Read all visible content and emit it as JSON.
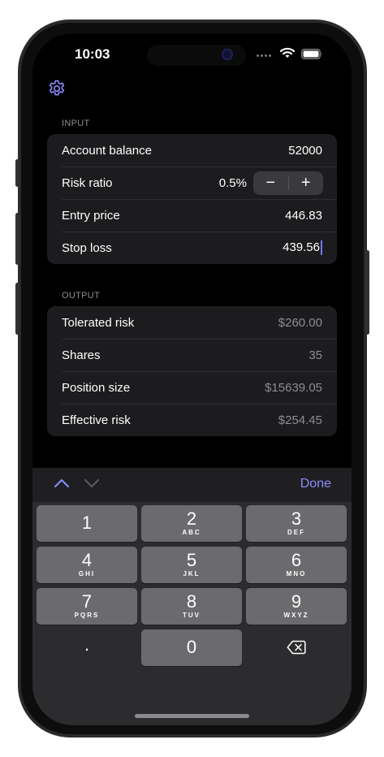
{
  "status_bar": {
    "time": "10:03"
  },
  "icons": {
    "settings": "gear-icon",
    "wifi": "wifi-icon",
    "battery": "battery-icon",
    "signal": "cellular-signal-icon",
    "prev": "chevron-up-icon",
    "next": "chevron-down-icon",
    "delete": "delete-backspace-icon"
  },
  "colors": {
    "accent": "#8c8cff",
    "background": "#000000",
    "group": "#1c1c1e",
    "muted_text": "#8d8d93",
    "key": "#6b6b6e",
    "keyboard_bg": "#2c2c2e"
  },
  "input": {
    "section_label": "INPUT",
    "account_balance": {
      "label": "Account balance",
      "value": "52000"
    },
    "risk_ratio": {
      "label": "Risk ratio",
      "value": "0.5%",
      "decrement": "−",
      "increment": "+"
    },
    "entry_price": {
      "label": "Entry price",
      "value": "446.83"
    },
    "stop_loss": {
      "label": "Stop loss",
      "value": "439.56"
    }
  },
  "output": {
    "section_label": "OUTPUT",
    "tolerated_risk": {
      "label": "Tolerated risk",
      "value": "$260.00"
    },
    "shares": {
      "label": "Shares",
      "value": "35"
    },
    "position_size": {
      "label": "Position size",
      "value": "$15639.05"
    },
    "effective_risk": {
      "label": "Effective risk",
      "value": "$254.45"
    }
  },
  "keyboard_toolbar": {
    "done_label": "Done"
  },
  "keypad": {
    "k1": {
      "num": "1",
      "letters": ""
    },
    "k2": {
      "num": "2",
      "letters": "ABC"
    },
    "k3": {
      "num": "3",
      "letters": "DEF"
    },
    "k4": {
      "num": "4",
      "letters": "GHI"
    },
    "k5": {
      "num": "5",
      "letters": "JKL"
    },
    "k6": {
      "num": "6",
      "letters": "MNO"
    },
    "k7": {
      "num": "7",
      "letters": "PQRS"
    },
    "k8": {
      "num": "8",
      "letters": "TUV"
    },
    "k9": {
      "num": "9",
      "letters": "WXYZ"
    },
    "k0": {
      "num": "0"
    },
    "decimal": "."
  }
}
